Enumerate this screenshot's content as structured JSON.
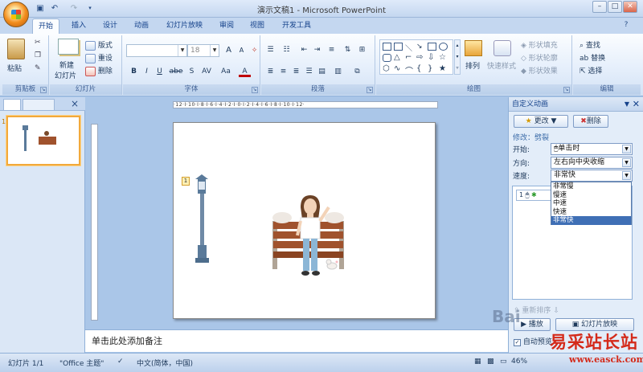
{
  "window": {
    "title": "演示文稿1 - Microsoft PowerPoint"
  },
  "tabs": [
    "开始",
    "插入",
    "设计",
    "动画",
    "幻灯片放映",
    "审阅",
    "视图",
    "开发工具"
  ],
  "ribbon": {
    "clipboard": {
      "paste": "粘贴",
      "label": "剪贴板"
    },
    "slides": {
      "new_slide_1": "新建",
      "new_slide_2": "幻灯片",
      "layout": "版式",
      "reset": "重设",
      "delete": "删除",
      "label": "幻灯片"
    },
    "font": {
      "font_name": "",
      "font_size": "18",
      "grow": "A",
      "shrink": "A",
      "bold": "B",
      "italic": "I",
      "underline": "U",
      "strike": "abe",
      "shadow": "S",
      "spacing": "AV",
      "case": "Aa",
      "color": "A",
      "label": "字体"
    },
    "paragraph": {
      "label": "段落"
    },
    "drawing": {
      "arrange": "排列",
      "quick_styles": "快速样式",
      "fill": "形状填充",
      "outline": "形状轮廓",
      "effects": "形状效果",
      "label": "绘图"
    },
    "editing": {
      "find": "查找",
      "replace": "替换",
      "select": "选择",
      "label": "编辑"
    }
  },
  "outline_tabs": {
    "close": "×"
  },
  "thumbnail": {
    "number": "1"
  },
  "ruler": {
    "horizontal": "·12·I·10·I·8·I·6·I·4·I·2·I·0·I·2·I·4·I·6·I·8·I·10·I·12·"
  },
  "slide": {
    "anim_tag": "1"
  },
  "notes": {
    "placeholder": "单击此处添加备注"
  },
  "task_pane": {
    "title": "自定义动画",
    "change_button": "更改",
    "delete_button": "删除",
    "modify_label": "修改：劈裂",
    "start_label": "开始:",
    "start_value": "单击时",
    "direction_label": "方向:",
    "direction_value": "左右向中央收缩",
    "speed_label": "速度:",
    "speed_value": "非常快",
    "speed_options": [
      "非常慢",
      "慢速",
      "中速",
      "快速",
      "非常快"
    ],
    "list_item_num": "1",
    "reorder": "重新排序",
    "play": "播放",
    "slideshow": "幻灯片放映",
    "autopreview": "自动预览"
  },
  "status": {
    "slide": "幻灯片 1/1",
    "theme": "\"Office 主题\"",
    "language": "中文(简体，中国)",
    "zoom": "46%"
  },
  "watermarks": {
    "baidu": "Bai",
    "site_cn": "易采站长站",
    "site_url": "www.easck.com"
  },
  "colors": {
    "accent": "#f2a93b",
    "selection": "#3f6fb5",
    "bench": "#a0522d",
    "lamp": "#5a7a9a"
  }
}
